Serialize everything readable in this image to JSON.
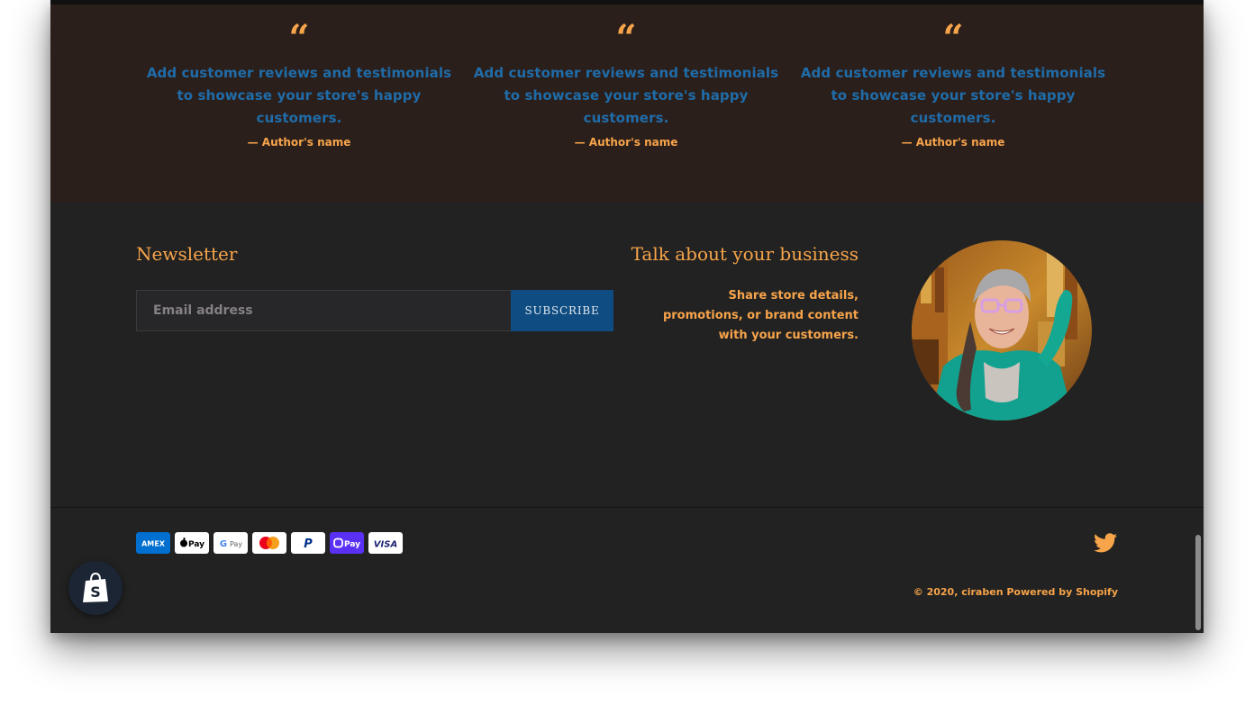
{
  "testimonials": [
    {
      "quote_icon": "quote-icon",
      "text": "Add customer reviews and testimonials to showcase your store's happy customers.",
      "author": "— Author's name"
    },
    {
      "quote_icon": "quote-icon",
      "text": "Add customer reviews and testimonials to showcase your store's happy customers.",
      "author": "— Author's name"
    },
    {
      "quote_icon": "quote-icon",
      "text": "Add customer reviews and testimonials to showcase your store's happy customers.",
      "author": "— Author's name"
    }
  ],
  "newsletter": {
    "title": "Newsletter",
    "email_placeholder": "Email address",
    "subscribe_label": "SUBSCRIBE"
  },
  "business": {
    "title": "Talk about your business",
    "text": "Share store details, promotions, or brand content with your customers."
  },
  "payments": [
    "American Express",
    "Apple Pay",
    "Google Pay",
    "Mastercard",
    "PayPal",
    "Shop Pay",
    "Visa"
  ],
  "payment_labels": {
    "amex": "AMEX",
    "apple": "Pay",
    "google": "Pay",
    "paypal": "P",
    "shop": "Pay",
    "visa": "VISA"
  },
  "social": {
    "twitter_icon": "twitter-icon"
  },
  "footer": {
    "copyright": "© 2020, ciraben",
    "powered_by": "Powered by Shopify"
  },
  "colors": {
    "accent": "#f7a44a",
    "testimonial_text": "#1f6ca8",
    "background": "#222222",
    "testimonial_background": "#2b1f1c",
    "button": "#0f4c81"
  }
}
